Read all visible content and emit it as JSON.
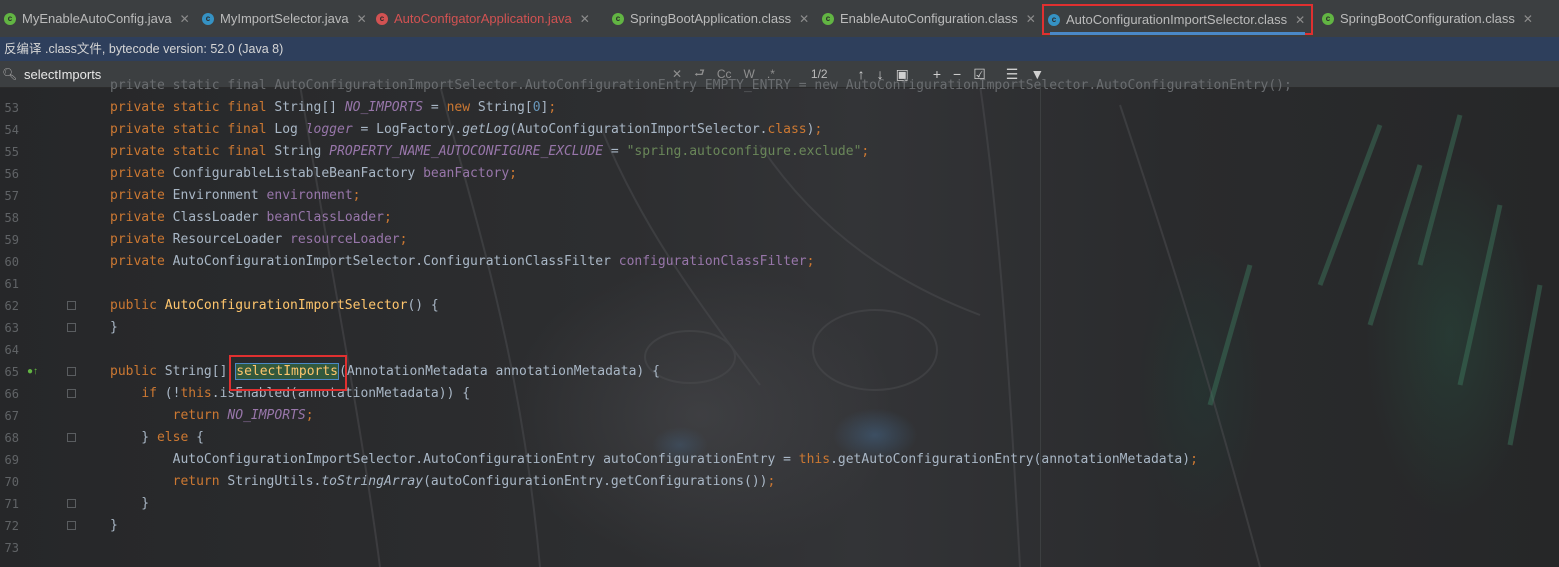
{
  "tabs": [
    {
      "label": "MyEnableAutoConfig.java",
      "kind": "java",
      "color": "#62b543",
      "text_color": "#bbbbbb"
    },
    {
      "label": "MyImportSelector.java",
      "kind": "java",
      "color": "#3592c4",
      "text_color": "#bbbbbb"
    },
    {
      "label": "AutoConfigatorApplication.java",
      "kind": "java",
      "color": "#d25252",
      "text_color": "#d25252"
    },
    {
      "label": "SpringBootApplication.class",
      "kind": "class",
      "color": "#62b543",
      "text_color": "#bbbbbb"
    },
    {
      "label": "EnableAutoConfiguration.class",
      "kind": "class",
      "color": "#62b543",
      "text_color": "#bbbbbb"
    },
    {
      "label": "AutoConfigurationImportSelector.class",
      "kind": "class",
      "color": "#3592c4",
      "text_color": "#bbbbbb",
      "active": true
    },
    {
      "label": "SpringBootConfiguration.class",
      "kind": "class",
      "color": "#62b543",
      "text_color": "#bbbbbb"
    }
  ],
  "notice": {
    "text": "反编译 .class文件, bytecode version: 52.0 (Java 8)"
  },
  "search": {
    "value": "selectImports",
    "match_count": "1/2",
    "opt_case": "Cc",
    "opt_words": "W",
    "opt_regex": ".*"
  },
  "lines": [
    {
      "n": "53",
      "html": "<span class=\"kw\">private static final </span>String[] <span class=\"sfld\">NO_IMPORTS</span> = <span class=\"kw\">new </span>String[<span style=\"color:#6897bb\">0</span>]<span class=\"kw\">;</span>"
    },
    {
      "n": "54",
      "html": "<span class=\"kw\">private static final </span>Log <span class=\"sfld\">logger</span> = LogFactory.<span class=\"smeth\">getLog</span>(AutoConfigurationImportSelector.<span class=\"kw\">class</span>)<span class=\"kw\">;</span>"
    },
    {
      "n": "55",
      "html": "<span class=\"kw\">private static final </span>String <span class=\"sfld\">PROPERTY_NAME_AUTOCONFIGURE_EXCLUDE</span> = <span class=\"str\">\"spring.autoconfigure.exclude\"</span><span class=\"kw\">;</span>"
    },
    {
      "n": "56",
      "html": "<span class=\"kw\">private </span>ConfigurableListableBeanFactory <span class=\"fld\">beanFactory</span><span class=\"kw\">;</span>"
    },
    {
      "n": "57",
      "html": "<span class=\"kw\">private </span>Environment <span class=\"fld\">environment</span><span class=\"kw\">;</span>"
    },
    {
      "n": "58",
      "html": "<span class=\"kw\">private </span>ClassLoader <span class=\"fld\">beanClassLoader</span><span class=\"kw\">;</span>"
    },
    {
      "n": "59",
      "html": "<span class=\"kw\">private </span>ResourceLoader <span class=\"fld\">resourceLoader</span><span class=\"kw\">;</span>"
    },
    {
      "n": "60",
      "html": "<span class=\"kw\">private </span>AutoConfigurationImportSelector.ConfigurationClassFilter <span class=\"fld\">configurationClassFilter</span><span class=\"kw\">;</span>"
    },
    {
      "n": "61",
      "html": ""
    },
    {
      "n": "62",
      "html": "<span class=\"kw\">public </span><span class=\"meth\">AutoConfigurationImportSelector</span>() {",
      "fold": true
    },
    {
      "n": "63",
      "html": "}",
      "fold": true
    },
    {
      "n": "64",
      "html": ""
    },
    {
      "n": "65",
      "html": "<span class=\"kw\">public </span>String[] <span class=\"hl\">selectImports</span>(AnnotationMetadata annotationMetadata) {",
      "fold": true,
      "mark": true
    },
    {
      "n": "66",
      "html": "    <span class=\"kw\">if </span>(!<span class=\"kw\">this</span>.isEnabled(annotationMetadata)) {",
      "fold": true
    },
    {
      "n": "67",
      "html": "        <span class=\"kw\">return </span><span class=\"sfld\">NO_IMPORTS</span><span class=\"kw\">;</span>"
    },
    {
      "n": "68",
      "html": "    } <span class=\"kw\">else </span>{",
      "fold": true
    },
    {
      "n": "69",
      "html": "        AutoConfigurationImportSelector.AutoConfigurationEntry autoConfigurationEntry = <span class=\"kw\">this</span>.getAutoConfigurationEntry(annotationMetadata)<span class=\"kw\">;</span>"
    },
    {
      "n": "70",
      "html": "        <span class=\"kw\">return </span>StringUtils.<span class=\"smeth\">toStringArray</span>(autoConfigurationEntry.getConfigurations())<span class=\"kw\">;</span>"
    },
    {
      "n": "71",
      "html": "    }",
      "fold": true
    },
    {
      "n": "72",
      "html": "}",
      "fold": true
    },
    {
      "n": "73",
      "html": ""
    }
  ]
}
